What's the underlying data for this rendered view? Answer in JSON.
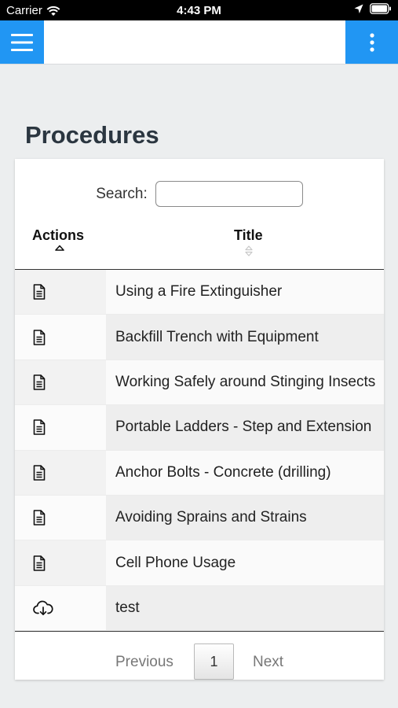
{
  "status_bar": {
    "carrier": "Carrier",
    "time": "4:43 PM"
  },
  "nav": {
    "menu_icon": "hamburger-menu-icon",
    "more_icon": "vertical-dots-icon",
    "accent_color": "#2196f3"
  },
  "page": {
    "title": "Procedures"
  },
  "search": {
    "label": "Search:",
    "value": "",
    "placeholder": ""
  },
  "table": {
    "columns": [
      "Actions",
      "Title"
    ],
    "sort": {
      "column": "Actions",
      "direction": "ascending"
    },
    "rows": [
      {
        "action_icon": "document-icon",
        "title": "Using a Fire Extinguisher"
      },
      {
        "action_icon": "document-icon",
        "title": "Backfill Trench with Equipment"
      },
      {
        "action_icon": "document-icon",
        "title": "Working Safely around Stinging Insects"
      },
      {
        "action_icon": "document-icon",
        "title": "Portable Ladders - Step and Extension"
      },
      {
        "action_icon": "document-icon",
        "title": "Anchor Bolts - Concrete (drilling)"
      },
      {
        "action_icon": "document-icon",
        "title": "Avoiding Sprains and Strains"
      },
      {
        "action_icon": "document-icon",
        "title": "Cell Phone Usage"
      },
      {
        "action_icon": "cloud-download-icon",
        "title": "test"
      }
    ]
  },
  "pagination": {
    "previous_label": "Previous",
    "current_page": "1",
    "next_label": "Next"
  }
}
